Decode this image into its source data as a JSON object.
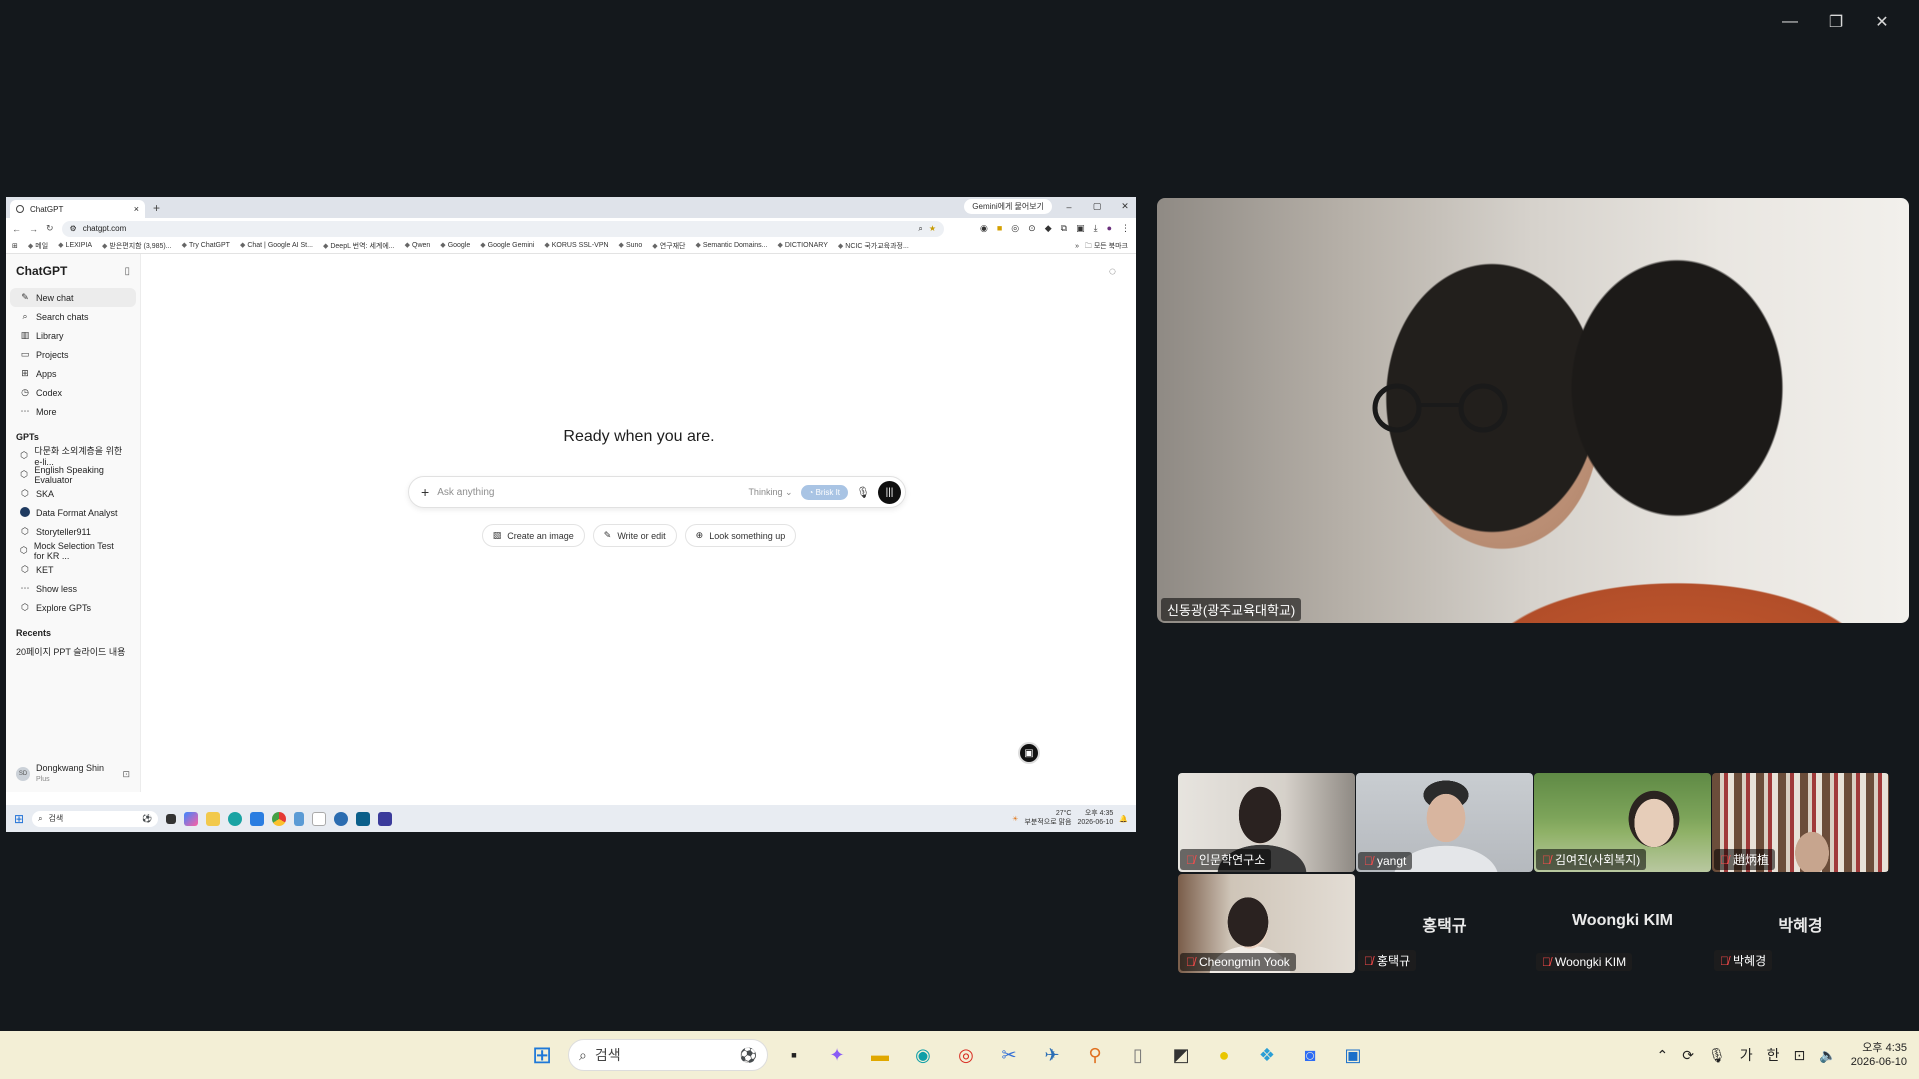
{
  "window_controls": {
    "minimize": "—",
    "restore": "❐",
    "close": "✕"
  },
  "browser": {
    "tab_title": "ChatGPT",
    "tab_close": "×",
    "new_tab": "+",
    "gemini_button": "Gemini에게 물어보기",
    "url": "chatgpt.com",
    "bookmarks": [
      "메일",
      "LEXIPIA",
      "받은편지함 (3,985)...",
      "Try ChatGPT",
      "Chat | Google AI St...",
      "DeepL 번역: 세계에...",
      "Qwen",
      "Google",
      "Google Gemini",
      "KORUS SSL-VPN",
      "Suno",
      "연구재단",
      "Semantic Domains...",
      "DICTIONARY",
      "NCIC 국가교육과정..."
    ],
    "bookmarks_more": "»",
    "bookmarks_folder": "모든 북마크"
  },
  "chatgpt": {
    "brand": "ChatGPT",
    "nav": [
      {
        "label": "New chat",
        "icon": "✎"
      },
      {
        "label": "Search chats",
        "icon": "⌕"
      },
      {
        "label": "Library",
        "icon": "▥"
      },
      {
        "label": "Projects",
        "icon": "▭"
      },
      {
        "label": "Apps",
        "icon": "⊞"
      },
      {
        "label": "Codex",
        "icon": "◷"
      },
      {
        "label": "More",
        "icon": "⋯"
      }
    ],
    "gpts_heading": "GPTs",
    "gpts": [
      "다문화 소외계층을 위한 e-li...",
      "English Speaking Evaluator",
      "SKA",
      "Data Format Analyst",
      "Storyteller911",
      "Mock Selection Test for KR ...",
      "KET"
    ],
    "show_less": "Show less",
    "explore": "Explore GPTs",
    "recents_heading": "Recents",
    "recent_item": "20페이지 PPT 슬라이드 내용",
    "user_name": "Dongkwang Shin",
    "user_plan": "Plus",
    "user_initials": "SD",
    "headline": "Ready when you are.",
    "composer_placeholder": "Ask anything",
    "thinking_label": "Thinking",
    "brisk_label": "Brisk It",
    "chips": [
      "Create an image",
      "Write or edit",
      "Look something up"
    ]
  },
  "inner_taskbar": {
    "search": "검색",
    "weather": "27°C",
    "weather_sub": "부분적으로 맑음",
    "time": "오후 4:35",
    "date": "2026-06-10"
  },
  "meeting": {
    "speaker_name": "신동광(광주교육대학교)",
    "participants": [
      {
        "name": "인문학연구소",
        "video": true
      },
      {
        "name": "yangt",
        "video": true
      },
      {
        "name": "김여진(사회복지)",
        "video": true
      },
      {
        "name": "趙炳植",
        "video": true
      },
      {
        "name": "Cheongmin Yook",
        "video": true
      },
      {
        "name": "홍택규",
        "video": false
      },
      {
        "name": "Woongki KIM",
        "video": false
      },
      {
        "name": "박혜경",
        "video": false
      }
    ]
  },
  "taskbar": {
    "search": "검색",
    "time": "오후 4:35",
    "date": "2026-06-10",
    "ime1": "가",
    "ime2": "한"
  }
}
